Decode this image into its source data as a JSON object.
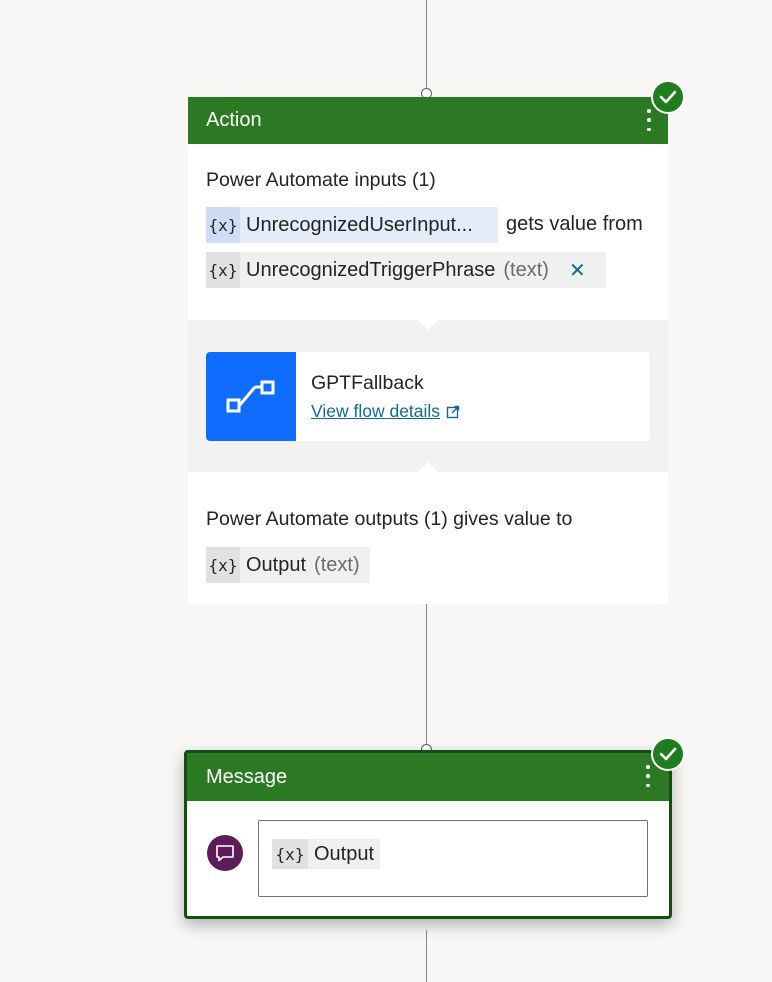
{
  "action_node": {
    "title": "Action",
    "inputs_label": "Power Automate inputs (1)",
    "input_param": {
      "var_icon": "{x}",
      "name": "UnrecognizedUserInput..."
    },
    "gets_value_from": "gets value from",
    "input_source": {
      "var_icon": "{x}",
      "name": "UnrecognizedTriggerPhrase",
      "type": "(text)"
    },
    "flow": {
      "name": "GPTFallback",
      "link": "View flow details"
    },
    "outputs_label": "Power Automate outputs (1) gives value to",
    "output_param": {
      "var_icon": "{x}",
      "name": "Output",
      "type": "(text)"
    }
  },
  "message_node": {
    "title": "Message",
    "variable": {
      "var_icon": "{x}",
      "name": "Output"
    }
  },
  "colors": {
    "header_green": "#2b7a23",
    "check_green": "#1f7d1f",
    "flow_blue": "#0f6cff",
    "link_teal": "#136a8a",
    "bubble_purple": "#5e1b59"
  },
  "icons": {
    "status": "checkmark-circle-icon",
    "menu": "more-vertical-icon",
    "flow": "power-automate-flow-icon",
    "external": "open-in-new-icon",
    "remove": "dismiss-icon",
    "message": "chat-bubble-icon"
  }
}
